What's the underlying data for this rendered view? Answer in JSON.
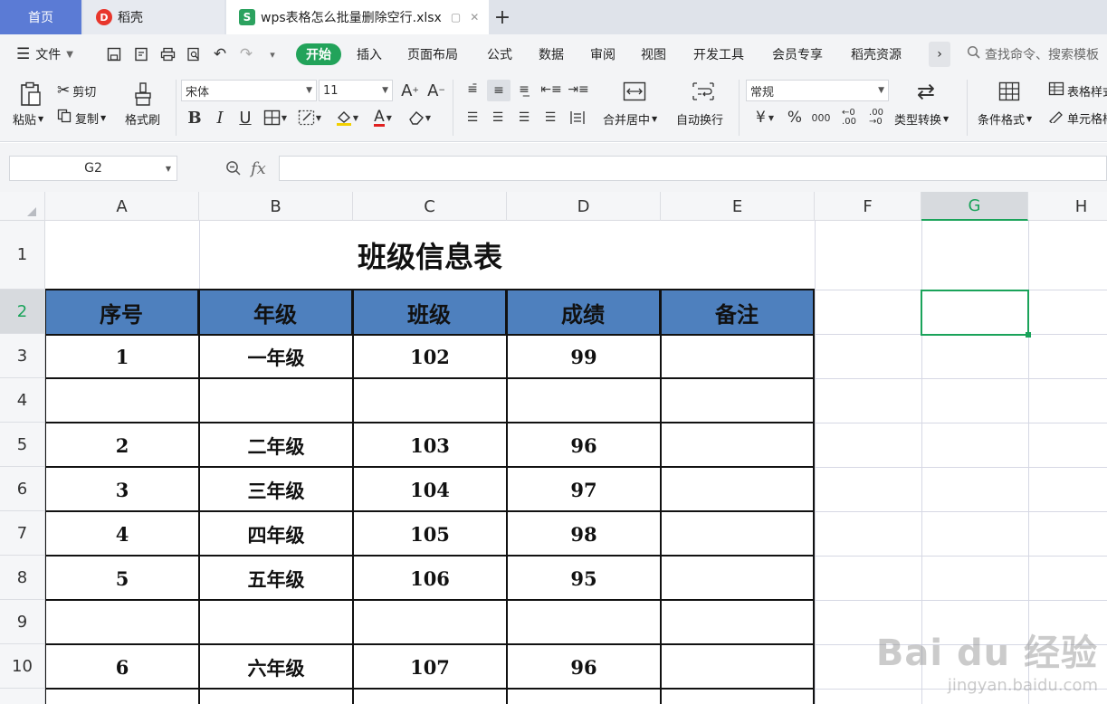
{
  "tabs": {
    "home": "首页",
    "daoke": "稻壳",
    "file": "wps表格怎么批量删除空行.xlsx",
    "logo_d": "D",
    "logo_s": "S"
  },
  "menu": {
    "file": "文件",
    "items": [
      "开始",
      "插入",
      "页面布局",
      "公式",
      "数据",
      "审阅",
      "视图",
      "开发工具",
      "会员专享",
      "稻壳资源"
    ],
    "search_placeholder": "查找命令、搜索模板"
  },
  "ribbon": {
    "paste": "粘贴",
    "cut": "剪切",
    "copy": "复制",
    "format_painter": "格式刷",
    "font_name": "宋体",
    "font_size": "11",
    "merge_center": "合并居中",
    "wrap_text": "自动换行",
    "number_format": "常规",
    "type_convert": "类型转换",
    "cond_format": "条件格式",
    "table_style": "表格样式",
    "cell_style": "单元格样式"
  },
  "formula": {
    "cell_ref": "G2",
    "fx": "fx"
  },
  "columns": [
    "A",
    "B",
    "C",
    "D",
    "E",
    "F",
    "G",
    "H"
  ],
  "rows": [
    "1",
    "2",
    "3",
    "4",
    "5",
    "6",
    "7",
    "8",
    "9",
    "10"
  ],
  "sheet": {
    "title": "班级信息表",
    "headers": [
      "序号",
      "年级",
      "班级",
      "成绩",
      "备注"
    ],
    "data": [
      [
        "1",
        "一年级",
        "102",
        "99",
        ""
      ],
      [
        "",
        "",
        "",
        "",
        ""
      ],
      [
        "2",
        "二年级",
        "103",
        "96",
        ""
      ],
      [
        "3",
        "三年级",
        "104",
        "97",
        ""
      ],
      [
        "4",
        "四年级",
        "105",
        "98",
        ""
      ],
      [
        "5",
        "五年级",
        "106",
        "95",
        ""
      ],
      [
        "",
        "",
        "",
        "",
        ""
      ],
      [
        "6",
        "六年级",
        "107",
        "96",
        ""
      ]
    ]
  },
  "watermark": {
    "main": "Bai du 经验",
    "sub": "jingyan.baidu.com"
  },
  "colors": {
    "header_fill": "#4e80be",
    "accent_green": "#1aa35a",
    "home_tab": "#5b7bd5"
  }
}
